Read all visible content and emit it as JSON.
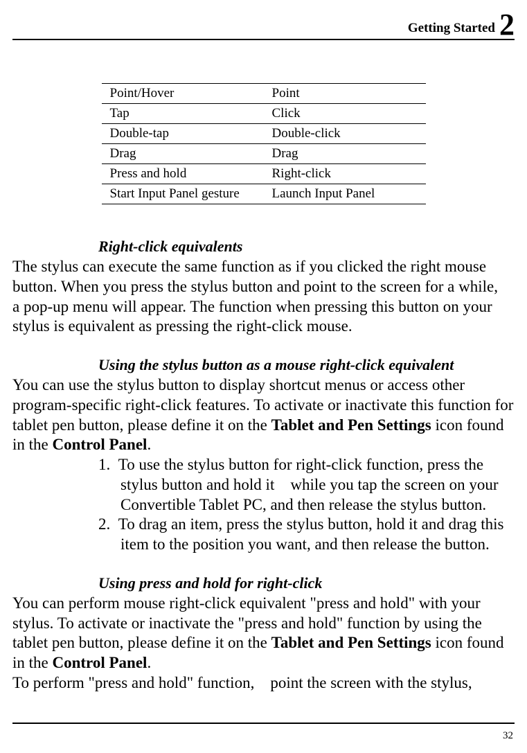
{
  "header": {
    "title": "Getting Started",
    "chapter": "2"
  },
  "table": {
    "rows": [
      {
        "left": "Point/Hover",
        "right": "Point"
      },
      {
        "left": "Tap",
        "right": "Click"
      },
      {
        "left": "Double-tap",
        "right": "Double-click"
      },
      {
        "left": "Drag",
        "right": "Drag"
      },
      {
        "left": "Press and hold",
        "right": "Right-click"
      },
      {
        "left": "Start Input Panel gesture",
        "right": "Launch Input Panel"
      }
    ]
  },
  "sections": {
    "s1": {
      "heading": "Right-click equivalents",
      "body": "The stylus can execute the same function as if you clicked the right mouse button. When you press the stylus button and point to the screen for a while, a pop-up menu will appear. The function when pressing this button on your stylus is equivalent as pressing the right-click mouse."
    },
    "s2": {
      "heading": "Using the stylus button as a mouse right-click equivalent",
      "body_pre": "You can use the stylus button to display shortcut menus or access other program-specific right-click features. To activate or inactivate this function for tablet pen button, please define it on the ",
      "bold1": "Tablet and Pen Settings",
      "body_mid": " icon found in the ",
      "bold2": "Control Panel",
      "body_post": ".",
      "li1_num": "1.",
      "li1": "To use the stylus button for right-click function, press the stylus button and hold it while you tap the screen on your Convertible Tablet PC, and then release the stylus button.",
      "li2_num": "2.",
      "li2": "To drag an item, press the stylus button, hold it and drag this item to the position you want, and then release the button."
    },
    "s3": {
      "heading": "Using press and hold for right-click",
      "body_pre": "You can perform mouse right-click equivalent \"press and hold\" with your stylus. To activate or inactivate the \"press and hold\" function by using the tablet pen button, please define it on the ",
      "bold1": "Tablet and Pen Settings",
      "body_mid": " icon found in the ",
      "bold2": "Control Panel",
      "body_post": ".",
      "body2": "To perform \"press and hold\" function, point the screen with the stylus,"
    }
  },
  "page": "32"
}
